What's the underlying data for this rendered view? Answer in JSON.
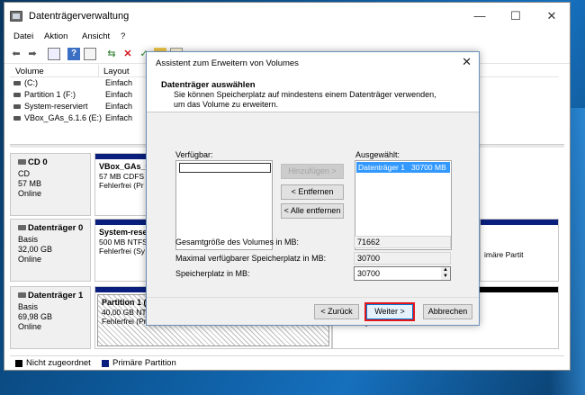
{
  "window": {
    "title": "Datenträgerverwaltung",
    "controls": {
      "minimize": "—",
      "maximize": "☐",
      "close": "✕"
    }
  },
  "menu": [
    "Datei",
    "Aktion",
    "Ansicht",
    "?"
  ],
  "volume_list": {
    "columns": [
      "Volume",
      "Layout"
    ],
    "rows": [
      {
        "name": "(C:)",
        "layout": "Einfach"
      },
      {
        "name": "Partition 1 (F:)",
        "layout": "Einfach"
      },
      {
        "name": "System-reserviert",
        "layout": "Einfach"
      },
      {
        "name": "VBox_GAs_6.1.6 (E:)",
        "layout": "Einfach"
      }
    ]
  },
  "disks": [
    {
      "name": "CD 0",
      "type": "CD",
      "size": "57 MB",
      "status": "Online",
      "partition": {
        "name": "VBox_GAs_6",
        "line2": "57 MB CDFS",
        "line3": "Fehlerfrei (Pr"
      }
    },
    {
      "name": "Datenträger 0",
      "type": "Basis",
      "size": "32,00 GB",
      "status": "Online",
      "partition": {
        "name": "System-rese",
        "line2": "500 MB NTFS",
        "line3": "Fehlerfrei (Sy"
      },
      "right_text": "imäre Partit"
    },
    {
      "name": "Datenträger 1",
      "type": "Basis",
      "size": "69,98 GB",
      "status": "Online",
      "partition": {
        "name": "Partition 1 (",
        "line2": "40,00 GB NTF",
        "line3": "Fehlerfrei (Primäre Partition)"
      },
      "unallocated": "Nicht zugeordnet"
    }
  ],
  "legend": [
    {
      "label": "Nicht zugeordnet",
      "color": "#000000"
    },
    {
      "label": "Primäre Partition",
      "color": "#0a1f7d"
    }
  ],
  "dialog": {
    "title": "Assistent zum Erweitern von Volumes",
    "close": "✕",
    "header_title": "Datenträger auswählen",
    "header_desc": "Sie können Speicherplatz auf mindestens einem Datenträger verwenden, um das Volume zu erweitern.",
    "available_label": "Verfügbar:",
    "selected_label": "Ausgewählt:",
    "selected_item": {
      "disk": "Datenträger 1",
      "size": "30700 MB"
    },
    "add_button": "Hinzufügen >",
    "remove_button": "< Entfernen",
    "remove_all_button": "< Alle entfernen",
    "total_size_label": "Gesamtgröße des Volumes in MB:",
    "total_size_value": "71662",
    "max_space_label": "Maximal verfügbarer Speicherplatz in MB:",
    "max_space_value": "30700",
    "space_label": "Speicherplatz in MB:",
    "space_value": "30700",
    "back_button": "< Zurück",
    "next_button": "Weiter >",
    "cancel_button": "Abbrechen",
    "highlight_color": "#e3161c"
  }
}
